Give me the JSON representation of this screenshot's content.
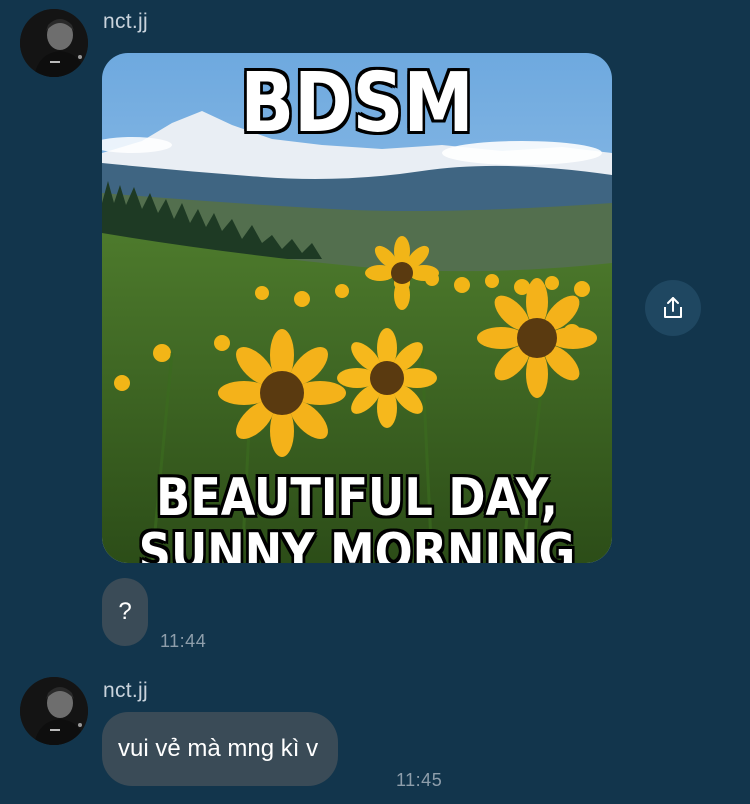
{
  "messages": [
    {
      "sender": "nct.jj",
      "type": "image",
      "meme_top_text": "BDSM",
      "meme_bottom_text_line1": "BEAUTIFUL DAY,",
      "meme_bottom_text_line2": "SUNNY MORNING"
    },
    {
      "type": "text",
      "text": "?",
      "time": "11:44"
    },
    {
      "sender": "nct.jj",
      "type": "text",
      "text": "vui vẻ mà mng kì v",
      "time": "11:45"
    }
  ],
  "icons": {
    "share": "share-icon",
    "avatar": "avatar"
  },
  "colors": {
    "background": "#12354c",
    "bubble": "#3a4b57",
    "share_button": "#1f4761",
    "timestamp": "#8e9eab",
    "sender_name": "#c9d3dc"
  }
}
